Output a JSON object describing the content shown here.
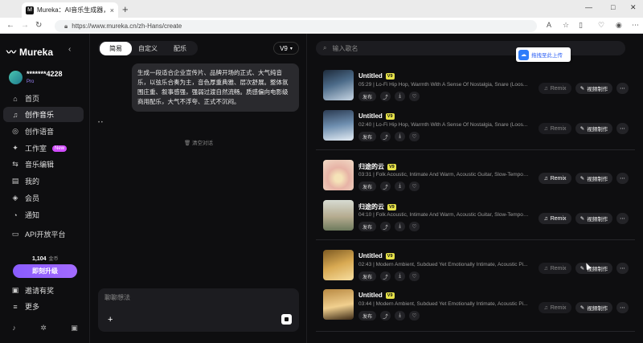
{
  "browser": {
    "tab_title": "Mureka：AI音乐生成器，轻松创作",
    "tab_close": "×",
    "new_tab": "+",
    "url": "https://www.mureka.cn/zh-Hans/create",
    "win_min": "—",
    "win_max": "□",
    "win_close": "✕"
  },
  "sidebar": {
    "logo": "Mureka",
    "username": "*******4228",
    "plan": "Pro",
    "items": [
      {
        "label": "首页",
        "icon": "⌂"
      },
      {
        "label": "创作音乐",
        "icon": "♫"
      },
      {
        "label": "创作语音",
        "icon": "◎"
      },
      {
        "label": "工作室",
        "icon": "✦",
        "badge": "New"
      },
      {
        "label": "音乐编辑",
        "icon": "⇆"
      },
      {
        "label": "我的",
        "icon": "▤"
      },
      {
        "label": "会员",
        "icon": "◈"
      },
      {
        "label": "通知",
        "icon": "◔"
      },
      {
        "label": "API开放平台",
        "icon": "▭"
      },
      {
        "label": "邀请有奖",
        "icon": "▣"
      },
      {
        "label": "更多",
        "icon": "≡"
      }
    ],
    "credits": "1,104",
    "credits_unit": "金币",
    "upgrade": "即刻升级"
  },
  "composer": {
    "tabs": [
      "简易",
      "自定义",
      "配乐"
    ],
    "model": "V9",
    "prompt_bubble": "生成一段适合企业宣传片、品牌开场的正式、大气纯音乐，以弦乐合奏为主，音色厚重典雅、层次舒展。整体氛围庄重、叙事感强，强弱过渡自然流畅。质感偏向电影级商用配乐，大气不浮夸、正式不沉闷。",
    "clear_chat": "清空对话",
    "input_placeholder": "聊聊想法"
  },
  "library": {
    "search_placeholder": "输入歌名",
    "float_button": "拖拽至此上传",
    "publish_label": "发布",
    "remix_label": "Remix",
    "video_label": "视频制作",
    "songs": [
      {
        "title": "Untitled",
        "badge": "V9",
        "meta": "05:29 | Lo-Fi Hip Hop, Warmth With A Sense Of Nostalgia, Snare (Loos...",
        "remix_enabled": false
      },
      {
        "title": "Untitled",
        "badge": "V9",
        "meta": "02:40 | Lo-Fi Hip Hop, Warmth With A Sense Of Nostalgia, Snare (Loos...",
        "remix_enabled": false
      },
      {
        "title": "归途的云",
        "badge": "V9",
        "meta": "03:31 | Folk Acoustic, Intimate And Warm, Acoustic Guitar, Slow-Tempo ...",
        "remix_enabled": true
      },
      {
        "title": "归途的云",
        "badge": "V9",
        "meta": "04:10 | Folk Acoustic, Intimate And Warm, Acoustic Guitar, Slow-Tempo ...",
        "remix_enabled": true
      },
      {
        "title": "Untitled",
        "badge": "V9",
        "meta": "02:43 | Modern Ambient, Subdued Yet Emotionally Intimate, Acoustic Pi...",
        "remix_enabled": false
      },
      {
        "title": "Untitled",
        "badge": "V9",
        "meta": "03:44 | Modern Ambient, Subdued Yet Emotionally Intimate, Acoustic Pi...",
        "remix_enabled": false
      }
    ]
  }
}
